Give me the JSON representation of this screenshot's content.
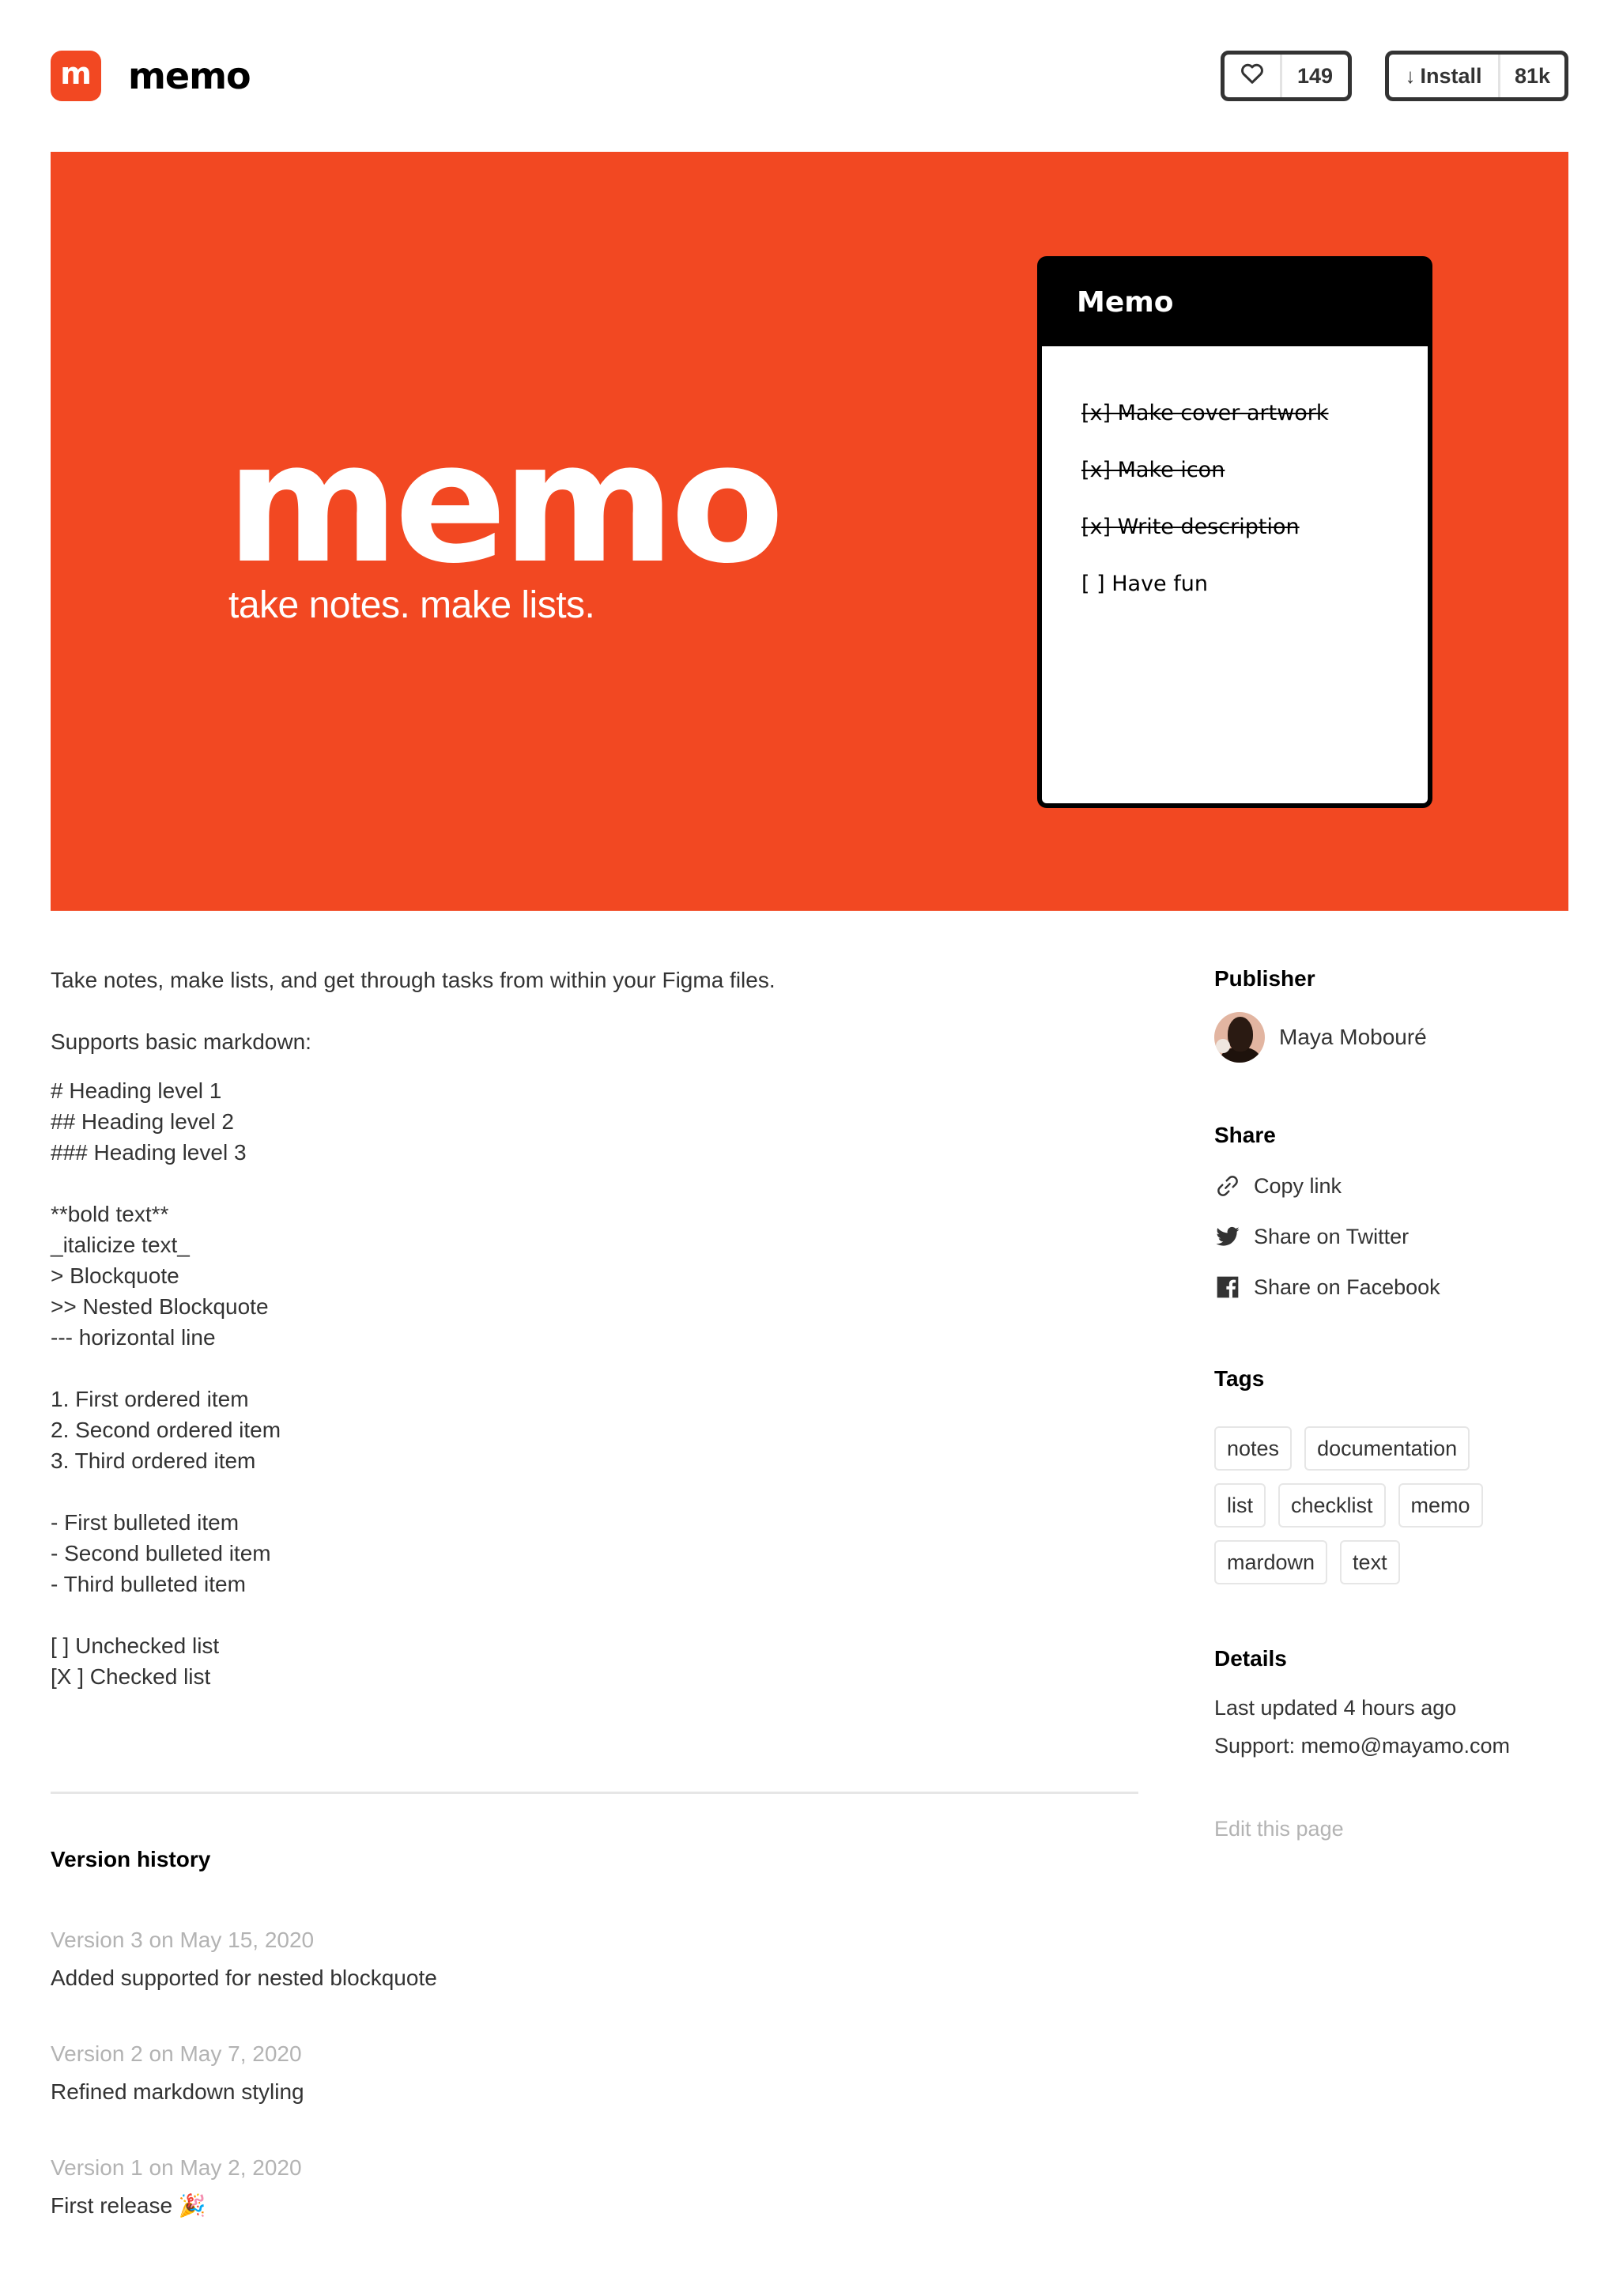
{
  "header": {
    "app_icon_letter": "m",
    "app_name": "memo",
    "like_count": "149",
    "install_label": "Install",
    "install_count": "81k",
    "icons": {
      "like": "heart-icon",
      "install": "arrow-down-icon"
    }
  },
  "banner": {
    "title": "memo",
    "tagline": "take notes. make lists.",
    "brand_color": "#F24822",
    "card": {
      "title": "Memo",
      "items": [
        {
          "text": "[x] Make cover artwork",
          "done": true
        },
        {
          "text": "[x] Make icon",
          "done": true
        },
        {
          "text": "[x] Write description",
          "done": true
        },
        {
          "text": "[ ] Have fun",
          "done": false
        }
      ]
    }
  },
  "description": {
    "intro": "Take notes, make lists, and get through tasks from within your Figma files.",
    "supports": "Supports basic markdown:",
    "headings": [
      "# Heading level 1",
      "## Heading level 2",
      "### Heading level 3"
    ],
    "formatting": [
      "**bold text**",
      "_italicize text_",
      "> Blockquote",
      ">> Nested Blockquote",
      "--- horizontal line"
    ],
    "ordered": [
      "1. First ordered item",
      "2. Second ordered item",
      "3. Third ordered item"
    ],
    "bulleted": [
      "- First bulleted item",
      "- Second bulleted item",
      "- Third bulleted item"
    ],
    "checklists": [
      "[ ] Unchecked list",
      "[X ] Checked list"
    ]
  },
  "version_history": {
    "title": "Version history",
    "versions": [
      {
        "meta": "Version 3 on May 15, 2020",
        "note": "Added supported for nested blockquote"
      },
      {
        "meta": "Version 2 on May 7, 2020",
        "note": "Refined markdown styling"
      },
      {
        "meta": "Version 1 on May 2, 2020",
        "note": "First release 🎉"
      }
    ]
  },
  "sidebar": {
    "publisher_heading": "Publisher",
    "publisher_name": "Maya Mobouré",
    "share_heading": "Share",
    "share": [
      {
        "label": "Copy link",
        "icon": "link-icon"
      },
      {
        "label": "Share on Twitter",
        "icon": "twitter-icon"
      },
      {
        "label": "Share on Facebook",
        "icon": "facebook-icon"
      }
    ],
    "tags_heading": "Tags",
    "tags": [
      "notes",
      "documentation",
      "list",
      "checklist",
      "memo",
      "mardown",
      "text"
    ],
    "details_heading": "Details",
    "last_updated": "Last updated 4 hours ago",
    "support": "Support: memo@mayamo.com",
    "edit_link": "Edit this page"
  }
}
